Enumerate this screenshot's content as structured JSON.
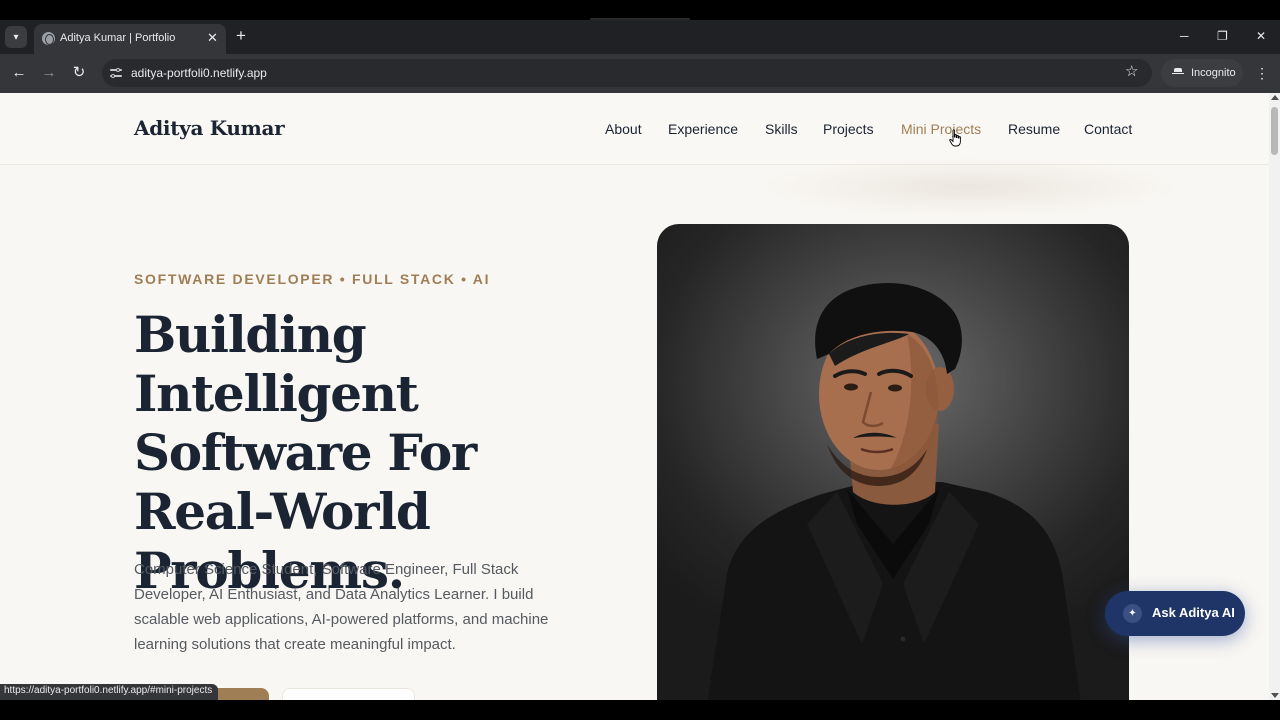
{
  "browser": {
    "tab_title": "Aditya Kumar | Portfolio",
    "tab_close": "✕",
    "new_tab": "+",
    "url": "aditya-portfoli0.netlify.app",
    "incognito_label": "Incognito",
    "status_url": "https://aditya-portfoli0.netlify.app/#mini-projects",
    "icons": {
      "tab_search": "▾",
      "back": "←",
      "forward": "→",
      "reload": "↻",
      "star": "☆",
      "kebab": "⋮",
      "minimize": "─",
      "restore": "❐",
      "close": "✕"
    }
  },
  "site": {
    "logo": "Aditya Kumar",
    "nav": [
      {
        "label": "About"
      },
      {
        "label": "Experience"
      },
      {
        "label": "Skills"
      },
      {
        "label": "Projects"
      },
      {
        "label": "Mini Projects"
      },
      {
        "label": "Resume"
      },
      {
        "label": "Contact"
      }
    ],
    "active_nav": "Mini Projects",
    "accent_color": "#a07e55",
    "ink_color": "#1b2432"
  },
  "hero": {
    "eyebrow": "SOFTWARE DEVELOPER • FULL STACK • AI",
    "headline": "Building Intelligent Software For Real-World Problems.",
    "intro": "Computer Science Student, Software Engineer, Full Stack Developer, AI Enthusiast, and Data Analytics Learner. I build scalable web applications, AI-powered platforms, and machine learning solutions that create meaningful impact."
  },
  "ask_ai": {
    "label": "Ask Aditya AI",
    "icon": "✦",
    "color": "#1f3567"
  }
}
